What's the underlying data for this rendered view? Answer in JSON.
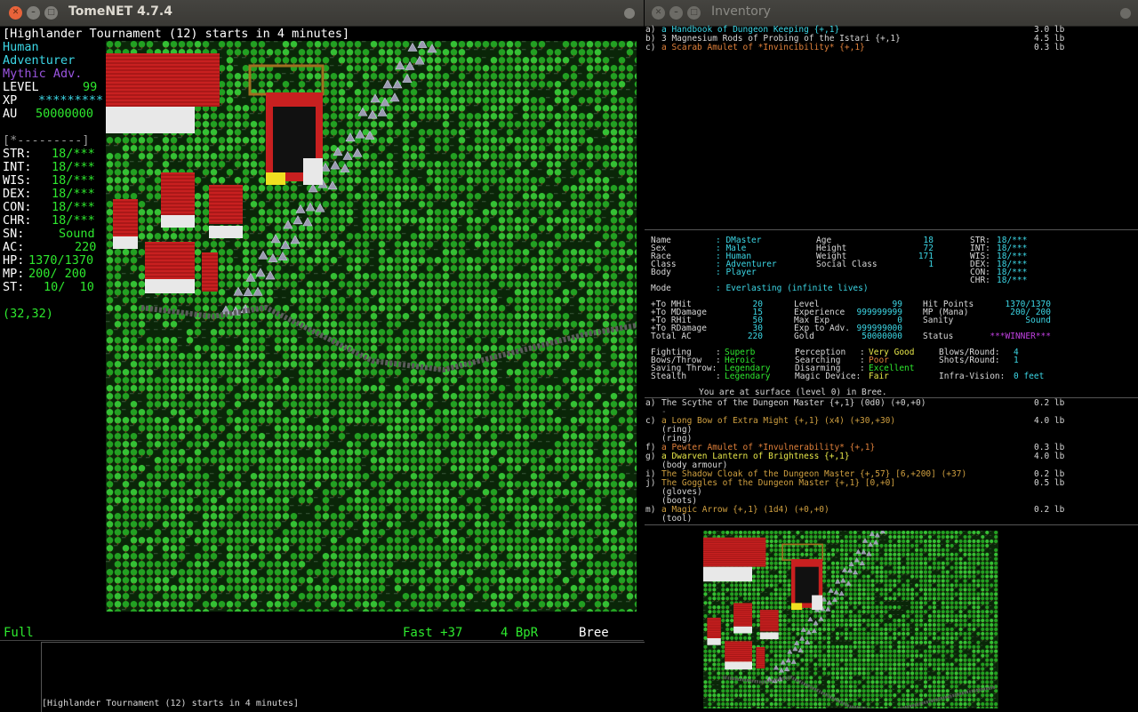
{
  "main_window": {
    "title": "TomeNET 4.7.4",
    "header_message": "[Highlander Tournament (12) starts in 4 minutes]",
    "sidebar": {
      "race": "Human",
      "class": "Adventurer",
      "title": "Mythic Adv.",
      "level_label": "LEVEL",
      "level_value": "99",
      "xp_label": "XP",
      "xp_value": "*********",
      "au_label": "AU",
      "au_value": "50000000",
      "exp_bar": "[*---------]",
      "stats": [
        {
          "name": "STR:",
          "value": "18/***"
        },
        {
          "name": "INT:",
          "value": "18/***"
        },
        {
          "name": "WIS:",
          "value": "18/***"
        },
        {
          "name": "DEX:",
          "value": "18/***"
        },
        {
          "name": "CON:",
          "value": "18/***"
        },
        {
          "name": "CHR:",
          "value": "18/***"
        }
      ],
      "sn_label": "SN:",
      "sn_value": "Sound",
      "ac_label": "AC:",
      "ac_value": "220",
      "hp_label": "HP:",
      "hp_value": "1370/1370",
      "mp_label": "MP:",
      "mp_value": "200/ 200",
      "st_label": "ST:",
      "st_value": "10/  10",
      "coords": "(32,32)"
    },
    "status_bar": {
      "hunger": "Full",
      "speed": "Fast +37",
      "bpr": "4 BpR",
      "location": "Bree"
    },
    "message_log": "[Highlander Tournament (12) starts in 4 minutes]"
  },
  "inventory_window": {
    "title": "Inventory",
    "items": [
      {
        "slot": "a)",
        "name": "a Handbook of Dungeon Keeping {+,1}",
        "weight": "3.0 lb",
        "color": "#3cd7e6"
      },
      {
        "slot": "b)",
        "name": "3 Magnesium Rods of Probing of the Istari {+,1}",
        "weight": "4.5 lb",
        "color": "#d8d8d8"
      },
      {
        "slot": "c)",
        "name": "a Scarab Amulet of *Invincibility* {+,1}",
        "weight": "0.3 lb",
        "color": "#e0803a"
      }
    ],
    "character": {
      "left": [
        [
          "Name",
          ": DMaster"
        ],
        [
          "Sex",
          ": Male"
        ],
        [
          "Race",
          ": Human"
        ],
        [
          "Class",
          ": Adventurer"
        ],
        [
          "Body",
          ": Player"
        ]
      ],
      "mid": [
        [
          "Age",
          "18"
        ],
        [
          "Height",
          "72"
        ],
        [
          "Weight",
          "171"
        ],
        [
          "Social Class",
          "1"
        ]
      ],
      "right": [
        [
          "STR:",
          "18/***"
        ],
        [
          "INT:",
          "18/***"
        ],
        [
          "WIS:",
          "18/***"
        ],
        [
          "DEX:",
          "18/***"
        ],
        [
          "CON:",
          "18/***"
        ],
        [
          "CHR:",
          "18/***"
        ]
      ],
      "mode_label": "Mode",
      "mode_value": ": Everlasting (infinite lives)",
      "combat": [
        [
          "+To MHit",
          "20"
        ],
        [
          "+To MDamage",
          "15"
        ],
        [
          "+To RHit",
          "50"
        ],
        [
          "+To RDamage",
          "30"
        ],
        [
          "Total AC",
          "220"
        ]
      ],
      "progress": [
        [
          "Level",
          "99"
        ],
        [
          "Experience",
          "999999999"
        ],
        [
          "Max Exp",
          "0"
        ],
        [
          "Exp to Adv.",
          "999999000"
        ],
        [
          "Gold",
          "50000000"
        ]
      ],
      "vitals": [
        [
          "Hit Points",
          "1370/1370"
        ],
        [
          "MP (Mana)",
          "200/ 200"
        ],
        [
          "Sanity",
          "Sound"
        ],
        [
          "",
          ""
        ],
        [
          "Status",
          "***WINNER***"
        ]
      ],
      "skills_a": [
        [
          "Fighting",
          ": Superb"
        ],
        [
          "Bows/Throw",
          ": Heroic"
        ],
        [
          "Saving Throw:",
          "Legendary"
        ],
        [
          "Stealth",
          ": Legendary"
        ]
      ],
      "skills_b": [
        [
          "Perception",
          ": Very Good"
        ],
        [
          "Searching",
          ": Poor"
        ],
        [
          "Disarming",
          ": Excellent"
        ],
        [
          "Magic Device:",
          "Fair"
        ]
      ],
      "skills_c": [
        [
          "Blows/Round:",
          "4"
        ],
        [
          "Shots/Round:",
          "1"
        ],
        [
          "",
          ""
        ],
        [
          "Infra-Vision:",
          "0 feet"
        ]
      ],
      "location_line": "You are at surface (level 0) in Bree."
    },
    "equipment": [
      {
        "slot": "a)",
        "name": "The Scythe of the Dungeon Master {+,1} (0d0) (+0,+0)",
        "weight": "0.2 lb",
        "color": "#d8d8d8"
      },
      {
        "slot": "",
        "name": "-",
        "weight": "",
        "color": "#777777"
      },
      {
        "slot": "c)",
        "name": "a Long Bow of Extra Might {+,1} (x4) (+30,+30)",
        "weight": "4.0 lb",
        "color": "#d0a040"
      },
      {
        "slot": "",
        "name": "(ring)",
        "weight": "",
        "color": "#d8d8d8"
      },
      {
        "slot": "",
        "name": "(ring)",
        "weight": "",
        "color": "#d8d8d8"
      },
      {
        "slot": "f)",
        "name": "a Pewter Amulet of *Invulnerability* {+,1}",
        "weight": "0.3 lb",
        "color": "#e0803a"
      },
      {
        "slot": "g)",
        "name": "a Dwarven Lantern of Brightness {+,1}",
        "weight": "4.0 lb",
        "color": "#e8e84a"
      },
      {
        "slot": "",
        "name": "(body armour)",
        "weight": "",
        "color": "#d8d8d8"
      },
      {
        "slot": "i)",
        "name": "The Shadow Cloak of the Dungeon Master {+,57} [6,+200] (+37)",
        "weight": "0.2 lb",
        "color": "#d0a040"
      },
      {
        "slot": "j)",
        "name": "The Goggles of the Dungeon Master {+,1} [0,+0]",
        "weight": "0.5 lb",
        "color": "#d0a040"
      },
      {
        "slot": "",
        "name": "(gloves)",
        "weight": "",
        "color": "#d8d8d8"
      },
      {
        "slot": "",
        "name": "(boots)",
        "weight": "",
        "color": "#d8d8d8"
      },
      {
        "slot": "m)",
        "name": "a Magic Arrow {+,1} (1d4) (+0,+0)",
        "weight": "0.2 lb",
        "color": "#d0a040"
      },
      {
        "slot": "",
        "name": "(tool)",
        "weight": "",
        "color": "#d8d8d8"
      }
    ]
  },
  "colors": {
    "accent_cyan": "#3cd7e6",
    "accent_green": "#2ee82e",
    "accent_purple": "#9a55e0",
    "tree_green": "#1f8a1f",
    "roof_red": "#c82020"
  }
}
